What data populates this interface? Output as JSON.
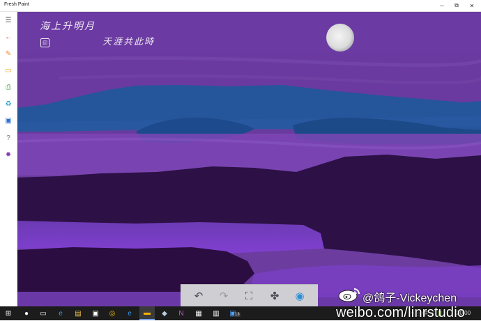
{
  "app": {
    "title": "Fresh Paint"
  },
  "window_controls": {
    "minimize": "─",
    "maximize": "⧉",
    "close": "✕"
  },
  "sidebar": {
    "items": [
      {
        "name": "menu",
        "glyph": "☰",
        "color": "#555555"
      },
      {
        "name": "back",
        "glyph": "←",
        "color": "#e0443a"
      },
      {
        "name": "paint",
        "glyph": "✎",
        "color": "#f08a24"
      },
      {
        "name": "open",
        "glyph": "▭",
        "color": "#e8a21a"
      },
      {
        "name": "print",
        "glyph": "⎙",
        "color": "#3aa13a"
      },
      {
        "name": "share",
        "glyph": "♻",
        "color": "#1fa0c8"
      },
      {
        "name": "save",
        "glyph": "▣",
        "color": "#2e6fd0"
      },
      {
        "name": "help",
        "glyph": "?",
        "color": "#777777"
      },
      {
        "name": "settings",
        "glyph": "✹",
        "color": "#8a3fb0"
      }
    ]
  },
  "painting": {
    "poem_line1": "海上升明月",
    "poem_line2": "天涯共此時",
    "seal": "印",
    "colors": {
      "sky": "#6a3a9e",
      "mountains": "#25579c",
      "shadow": "#2f1048",
      "water": "#7a3cc8"
    }
  },
  "toolbar": {
    "undo": "↶",
    "redo": "↷",
    "fit": "⛶",
    "fan": "✤",
    "camera": "◉"
  },
  "taskbar": {
    "start": "⊞",
    "search": "●",
    "taskview": "▭",
    "edge": "e",
    "explorer": "▤",
    "store": "▣",
    "weibo": "◎",
    "ie": "e",
    "freshpaint": "▬",
    "app8": "◆",
    "onenote": "N",
    "app10": "▦",
    "app11": "▥",
    "app12": "▣",
    "badge": "13"
  },
  "tray": {
    "time": "20:00",
    "icons": "^ ▭ 中 ◁ 🔋"
  },
  "watermark": {
    "handle": "@鸽子-Vickeychen",
    "site": "weibo.com/linrstudio"
  }
}
